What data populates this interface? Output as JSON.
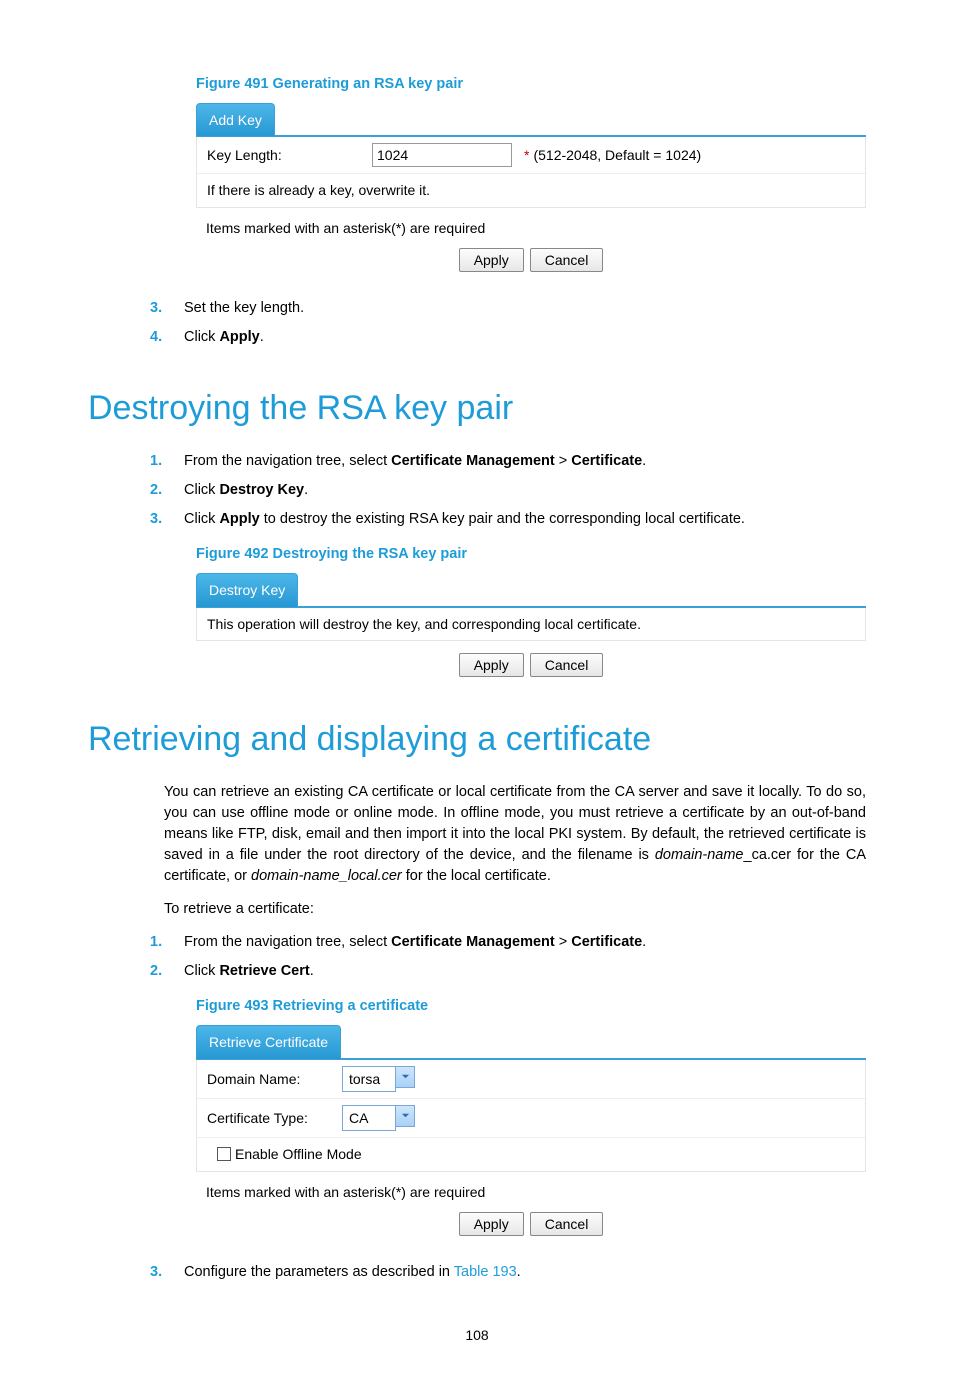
{
  "fig491": {
    "caption": "Figure 491 Generating an RSA key pair",
    "tab": "Add Key",
    "keylen_label": "Key Length:",
    "keylen_value": "1024",
    "keylen_hint": "(512-2048, Default = 1024)",
    "overwrite_note": "If there is already a key, overwrite it.",
    "required_note": "Items marked with an asterisk(*) are required",
    "apply": "Apply",
    "cancel": "Cancel"
  },
  "steps_a": {
    "s3": "Set the key length.",
    "s4_a": "Click ",
    "s4_b": "Apply",
    "s4_c": "."
  },
  "sect_destroy": {
    "title": "Destroying the RSA key pair",
    "s1_a": "From the navigation tree, select ",
    "s1_b": "Certificate Management",
    "s1_c": " > ",
    "s1_d": "Certificate",
    "s1_e": ".",
    "s2_a": "Click ",
    "s2_b": "Destroy Key",
    "s2_c": ".",
    "s3_a": "Click ",
    "s3_b": "Apply",
    "s3_c": " to destroy the existing RSA key pair and the corresponding local certificate."
  },
  "fig492": {
    "caption": "Figure 492 Destroying the RSA key pair",
    "tab": "Destroy Key",
    "note": "This operation will destroy the key, and corresponding local certificate.",
    "apply": "Apply",
    "cancel": "Cancel"
  },
  "sect_retrieve": {
    "title": "Retrieving and displaying a certificate",
    "para_a": "You can retrieve an existing CA certificate or local certificate from the CA server and save it locally. To do so, you can use offline mode or online mode. In offline mode, you must retrieve a certificate by an out-of-band means like FTP, disk, email and then import it into the local PKI system. By default, the retrieved certificate is saved in a file under the root directory of the device, and the filename is ",
    "para_b": "domain-name",
    "para_c": "_ca.cer for the CA certificate, or ",
    "para_d": "domain-name_local.cer",
    "para_e": " for the local certificate.",
    "lead": "To retrieve a certificate:",
    "s1_a": "From the navigation tree, select ",
    "s1_b": "Certificate Management",
    "s1_c": " > ",
    "s1_d": "Certificate",
    "s1_e": ".",
    "s2_a": "Click ",
    "s2_b": "Retrieve Cert",
    "s2_c": "."
  },
  "fig493": {
    "caption": "Figure 493 Retrieving a certificate",
    "tab": "Retrieve Certificate",
    "domain_label": "Domain Name:",
    "domain_value": "torsa",
    "cert_label": "Certificate Type:",
    "cert_value": "CA",
    "offline_label": "Enable Offline Mode",
    "required_note": "Items marked with an asterisk(*) are required",
    "apply": "Apply",
    "cancel": "Cancel"
  },
  "steps_c": {
    "s3_a": "Configure the parameters as described in ",
    "s3_b": "Table 193",
    "s3_c": "."
  },
  "page_number": "108"
}
